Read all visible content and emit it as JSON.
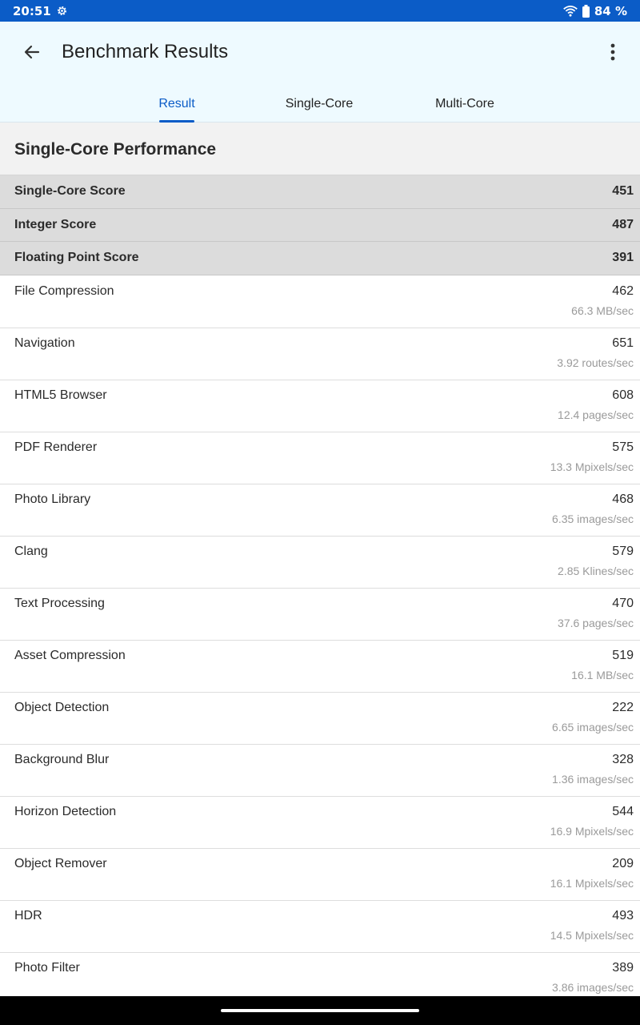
{
  "status_bar": {
    "time": "20:51",
    "battery": "84 %",
    "icons": [
      "settings-gear-icon",
      "wifi-icon",
      "battery-icon"
    ]
  },
  "app_bar": {
    "title": "Benchmark Results",
    "back_icon": "arrow-left-icon",
    "menu_icon": "more-vert-icon"
  },
  "tabs": [
    {
      "label": "Result",
      "active": true
    },
    {
      "label": "Single-Core",
      "active": false
    },
    {
      "label": "Multi-Core",
      "active": false
    }
  ],
  "colors": {
    "accent": "#0b5cc7",
    "appbar_bg": "#eefaff"
  },
  "section": {
    "title": "Single-Core Performance"
  },
  "summary": [
    {
      "label": "Single-Core Score",
      "value": "451"
    },
    {
      "label": "Integer Score",
      "value": "487"
    },
    {
      "label": "Floating Point Score",
      "value": "391"
    }
  ],
  "workloads": [
    {
      "name": "File Compression",
      "score": "462",
      "rate": "66.3 MB/sec"
    },
    {
      "name": "Navigation",
      "score": "651",
      "rate": "3.92 routes/sec"
    },
    {
      "name": "HTML5 Browser",
      "score": "608",
      "rate": "12.4 pages/sec"
    },
    {
      "name": "PDF Renderer",
      "score": "575",
      "rate": "13.3 Mpixels/sec"
    },
    {
      "name": "Photo Library",
      "score": "468",
      "rate": "6.35 images/sec"
    },
    {
      "name": "Clang",
      "score": "579",
      "rate": "2.85 Klines/sec"
    },
    {
      "name": "Text Processing",
      "score": "470",
      "rate": "37.6 pages/sec"
    },
    {
      "name": "Asset Compression",
      "score": "519",
      "rate": "16.1 MB/sec"
    },
    {
      "name": "Object Detection",
      "score": "222",
      "rate": "6.65 images/sec"
    },
    {
      "name": "Background Blur",
      "score": "328",
      "rate": "1.36 images/sec"
    },
    {
      "name": "Horizon Detection",
      "score": "544",
      "rate": "16.9 Mpixels/sec"
    },
    {
      "name": "Object Remover",
      "score": "209",
      "rate": "16.1 Mpixels/sec"
    },
    {
      "name": "HDR",
      "score": "493",
      "rate": "14.5 Mpixels/sec"
    },
    {
      "name": "Photo Filter",
      "score": "389",
      "rate": "3.86 images/sec"
    }
  ]
}
